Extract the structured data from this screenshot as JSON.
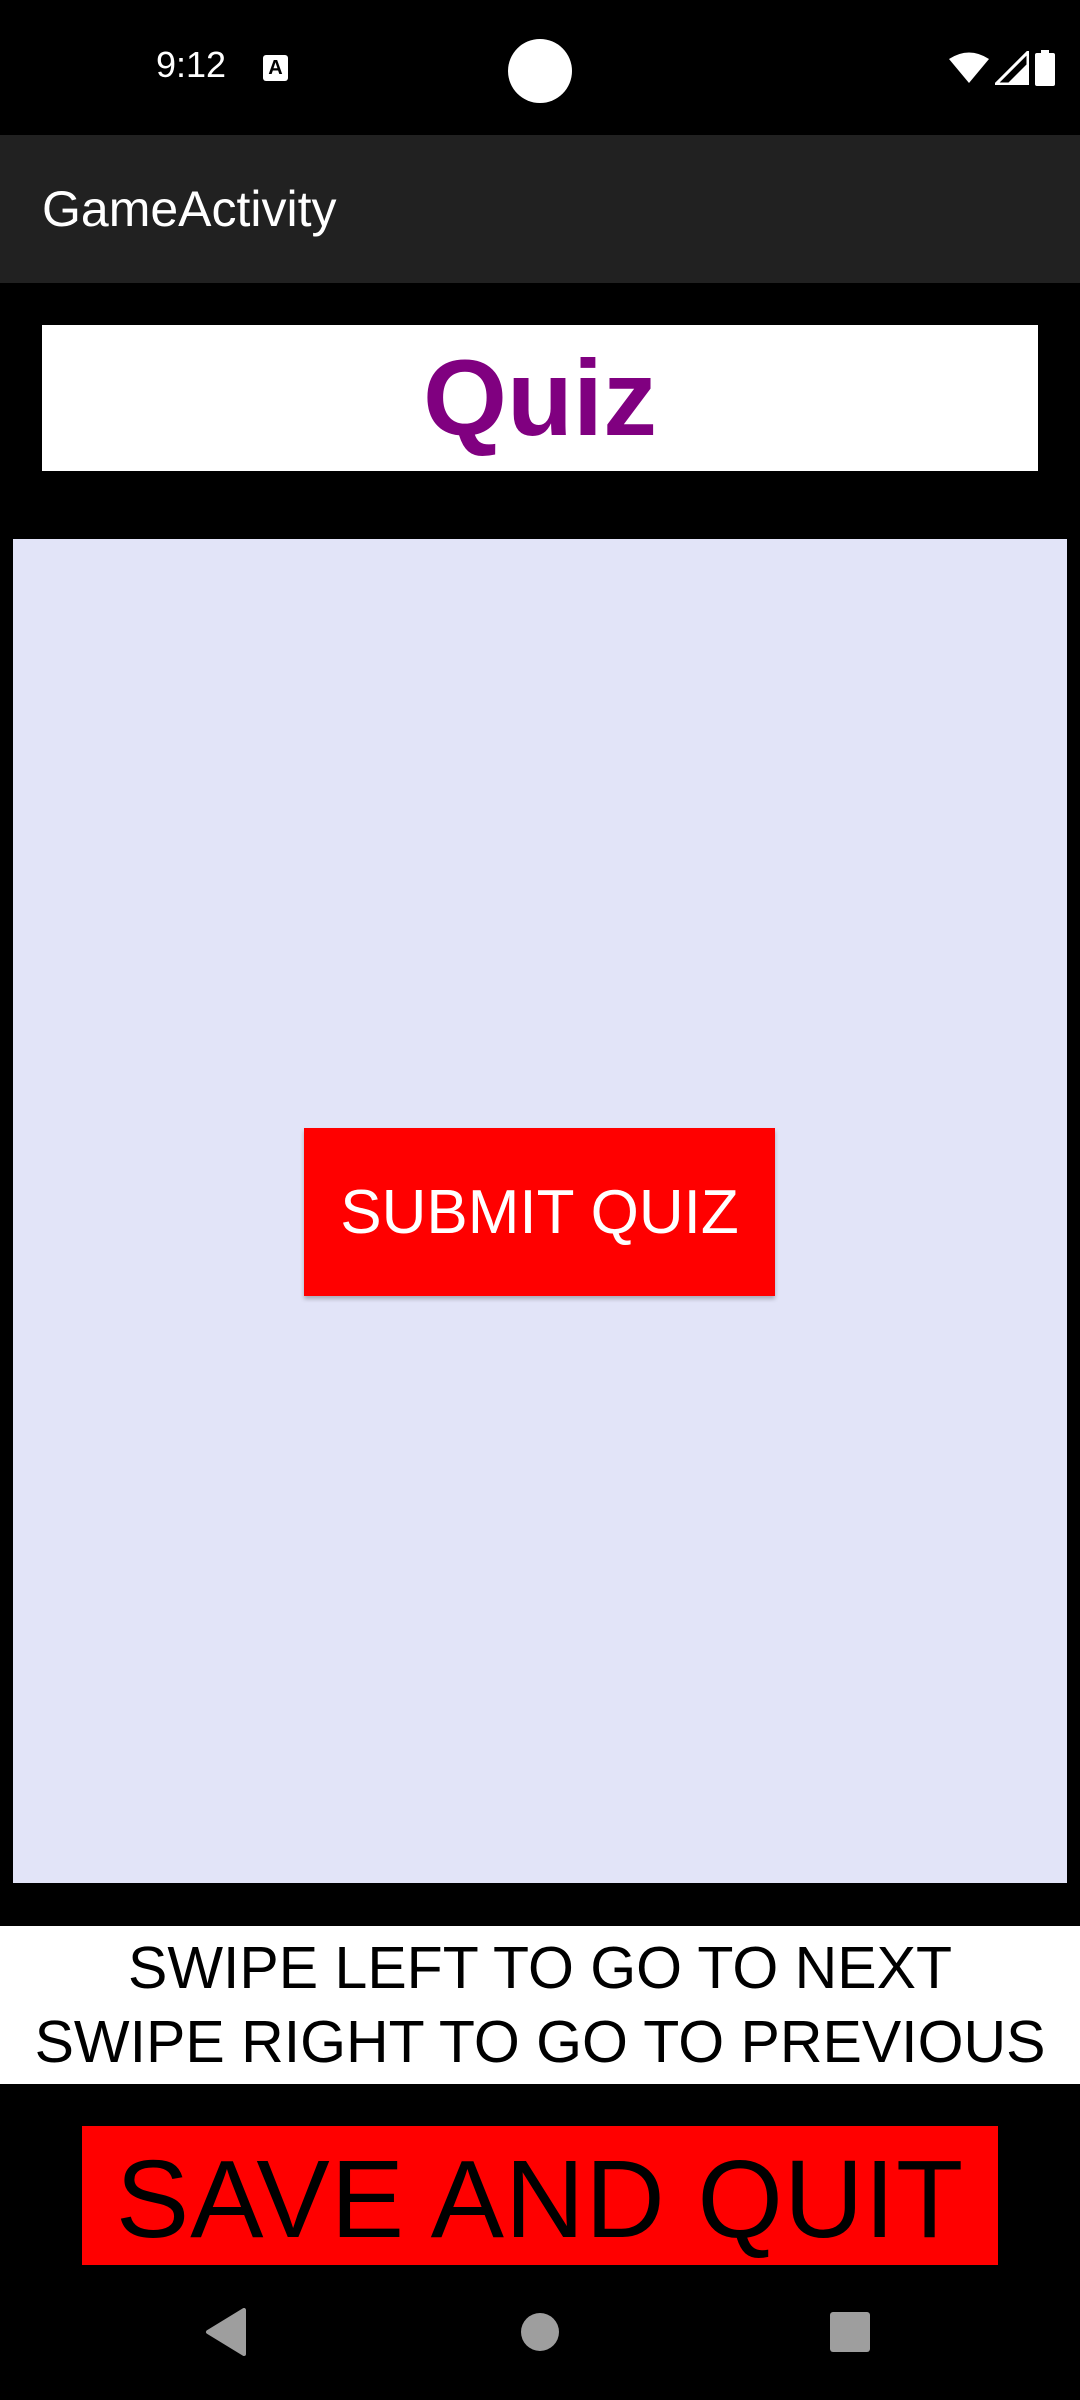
{
  "status_bar": {
    "time": "9:12",
    "notification_icon": "A",
    "icons": [
      "wifi-icon",
      "cellular-signal-icon",
      "battery-icon"
    ]
  },
  "app_bar": {
    "title": "GameActivity"
  },
  "quiz": {
    "title": "Quiz",
    "submit_label": "SUBMIT QUIZ"
  },
  "instructions": {
    "line1": "SWIPE LEFT TO GO TO NEXT",
    "line2": "SWIPE RIGHT TO GO TO PREVIOUS"
  },
  "actions": {
    "save_quit_label": "SAVE AND QUIT"
  },
  "nav_bar": {
    "buttons": [
      "back-icon",
      "home-icon",
      "recents-icon"
    ]
  },
  "colors": {
    "title_purple": "#800080",
    "button_red": "#ff0000",
    "panel_lavender": "#e2e4f8",
    "app_bar": "#212121"
  }
}
